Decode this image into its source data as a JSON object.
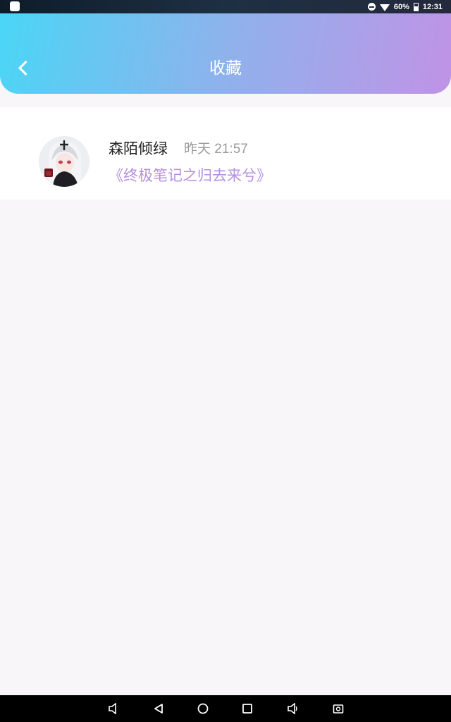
{
  "status_bar": {
    "battery": "60%",
    "time": "12:31",
    "icons": [
      "app-icon",
      "dnd-icon",
      "wifi-icon",
      "battery-icon"
    ]
  },
  "header": {
    "title": "收藏",
    "back_icon": "chevron-left-icon",
    "gradient": [
      "#4ad6f6",
      "#c093e6"
    ]
  },
  "favorites": [
    {
      "author": "森陌倾绿",
      "time": "昨天 21:57",
      "title": "《终极笔记之归去来兮》",
      "avatar": "anime-girl-avatar"
    }
  ],
  "colors": {
    "accent": "#b78fe0",
    "background": "#f8f6f8"
  },
  "nav_bar": {
    "buttons": [
      "volume-down-icon",
      "back-triangle-icon",
      "home-circle-icon",
      "recents-square-icon",
      "volume-up-icon",
      "screenshot-icon"
    ]
  }
}
